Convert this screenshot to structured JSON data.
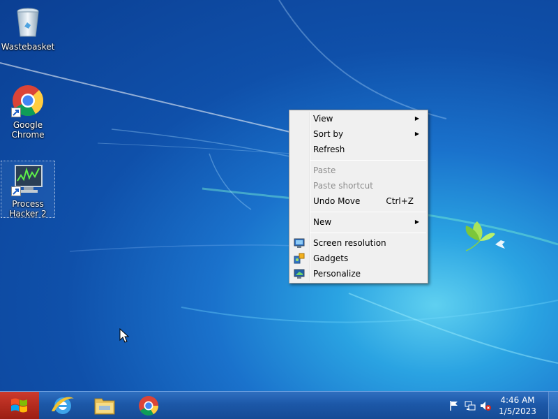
{
  "desktop": {
    "icons": [
      {
        "label": "Wastebasket",
        "icon": "recycle-bin-icon"
      },
      {
        "label": "Google Chrome",
        "icon": "chrome-icon"
      },
      {
        "label": "Process Hacker 2",
        "icon": "process-hacker-icon"
      }
    ]
  },
  "context_menu": {
    "items": [
      {
        "label": "View",
        "has_submenu": true
      },
      {
        "label": "Sort by",
        "has_submenu": true
      },
      {
        "label": "Refresh"
      },
      {
        "label": "Paste",
        "disabled": true
      },
      {
        "label": "Paste shortcut",
        "disabled": true
      },
      {
        "label": "Undo Move",
        "shortcut": "Ctrl+Z"
      },
      {
        "label": "New",
        "has_submenu": true
      },
      {
        "label": "Screen resolution",
        "icon": "monitor-icon"
      },
      {
        "label": "Gadgets",
        "icon": "gadgets-icon"
      },
      {
        "label": "Personalize",
        "icon": "personalize-icon"
      }
    ],
    "submenu_arrow": "▶"
  },
  "taskbar": {
    "pinned": [
      {
        "name": "Internet Explorer",
        "icon": "internet-explorer-icon"
      },
      {
        "name": "Windows Explorer",
        "icon": "file-explorer-icon"
      },
      {
        "name": "Google Chrome",
        "icon": "chrome-icon"
      }
    ],
    "clock": {
      "time": "4:46 AM",
      "date": "1/5/2023"
    },
    "tray_icons": [
      "action-center-flag-icon",
      "network-icon",
      "volume-muted-icon"
    ]
  },
  "colors": {
    "desktop_blue": "#1a72cc",
    "menu_bg": "#f0f0f0",
    "taskbar_blue": "#1c58a8"
  }
}
